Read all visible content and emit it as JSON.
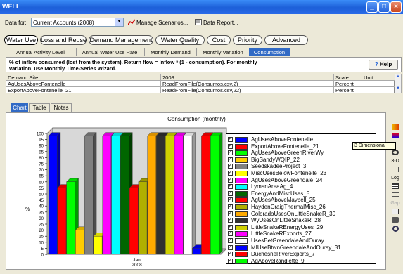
{
  "window": {
    "title": "WELL"
  },
  "toolbar": {
    "data_for_label": "Data for:",
    "dataset_value": "Current Accounts (2008)",
    "manage_scenarios_label": "Manage Scenarios...",
    "data_report_label": "Data Report..."
  },
  "main_tabs": [
    {
      "label": "Water Use"
    },
    {
      "label": "Loss and Reuse"
    },
    {
      "label": "Demand Management"
    },
    {
      "label": "Water Quality"
    },
    {
      "label": "Cost"
    },
    {
      "label": "Priority"
    },
    {
      "label": "Advanced"
    }
  ],
  "sub_tabs": [
    {
      "label": "Annual Activity Level"
    },
    {
      "label": "Annual Water Use Rate"
    },
    {
      "label": "Monthly Demand"
    },
    {
      "label": "Monthly Variation"
    },
    {
      "label": "Consumption"
    }
  ],
  "info": {
    "line1": "% of inflow consumed (lost from the system).  Return flow = Inflow * (1 - consumption).  For monthly",
    "line2": "variation, use Monthly Time-Series Wizard.",
    "help_label": "Help"
  },
  "grid": {
    "headers": [
      "Demand Site",
      "2008",
      "Scale",
      "Unit"
    ],
    "rows": [
      [
        "AgUsesAboveFontenelle",
        "ReadFromFile(Consumos.csv,2)",
        "Percent",
        ""
      ],
      [
        "ExportAboveFontenelle_21",
        "ReadFromFile(Consumos.csv,22)",
        "Percent",
        ""
      ]
    ]
  },
  "chart_tabs": [
    {
      "label": "Chart"
    },
    {
      "label": "Table"
    },
    {
      "label": "Notes"
    }
  ],
  "tooltip": "3 Dimensional",
  "right_tools": {
    "three_d": "3-D",
    "log": "Log"
  },
  "chart_data": {
    "type": "bar",
    "title": "Consumption (monthly)",
    "ylabel": "%",
    "xlabel": "",
    "x_tick_labels": [
      "Jan",
      "2008"
    ],
    "ylim": [
      0,
      100
    ],
    "yticks": [
      0,
      5,
      10,
      15,
      20,
      25,
      30,
      35,
      40,
      45,
      50,
      55,
      60,
      65,
      70,
      75,
      80,
      85,
      90,
      95,
      100
    ],
    "categories": [
      "Jan 2008"
    ],
    "series": [
      {
        "name": "AgUsesAboveFontenelle",
        "values": [
          98
        ],
        "color": "#0000ff"
      },
      {
        "name": "ExportAboveFontenelle_21",
        "values": [
          55
        ],
        "color": "#ff0000"
      },
      {
        "name": "AgUsesAboveGreenRiverWy",
        "values": [
          60
        ],
        "color": "#00ff00"
      },
      {
        "name": "BigSandyWQIP_22",
        "values": [
          20
        ],
        "color": "#ffcc00"
      },
      {
        "name": "SeedskadeeProject_3",
        "values": [
          98
        ],
        "color": "#808080"
      },
      {
        "name": "MiscUsesBelowFontenelle_23",
        "values": [
          15
        ],
        "color": "#ffff00"
      },
      {
        "name": "AgUsesAboveGreendale_24",
        "values": [
          98
        ],
        "color": "#ff00ff"
      },
      {
        "name": "LymanAreaAg_4",
        "values": [
          98
        ],
        "color": "#00ffff"
      },
      {
        "name": "EnergyAndMiscUses_5",
        "values": [
          98
        ],
        "color": "#006600"
      },
      {
        "name": "AgUsesAboveMaybell_25",
        "values": [
          55
        ],
        "color": "#ff0000"
      },
      {
        "name": "HaydenCraigThermalMisc_26",
        "values": [
          60
        ],
        "color": "#b0b000"
      },
      {
        "name": "ColoradoUsesOnLittleSnakeR_30",
        "values": [
          98
        ],
        "color": "#ffaa00"
      },
      {
        "name": "WyUsesOnLittleSnakeR_28",
        "values": [
          98
        ],
        "color": "#303030"
      },
      {
        "name": "LittleSnakeREnergyUses_29",
        "values": [
          98
        ],
        "color": "#d0d000"
      },
      {
        "name": "LittleSnakeRExports_27",
        "values": [
          98
        ],
        "color": "#ff00ff"
      },
      {
        "name": "UsesBetGreendaleAndOuray",
        "values": [
          98
        ],
        "color": "#ffffff"
      },
      {
        "name": "MIUseBtwnGreendaleAndOuray_31",
        "values": [
          5
        ],
        "color": "#0000ff"
      },
      {
        "name": "DuchesneRiverExports_7",
        "values": [
          98
        ],
        "color": "#ff0000"
      },
      {
        "name": "AgAboveRandlette_9",
        "values": [
          98
        ],
        "color": "#00ff00"
      }
    ]
  }
}
